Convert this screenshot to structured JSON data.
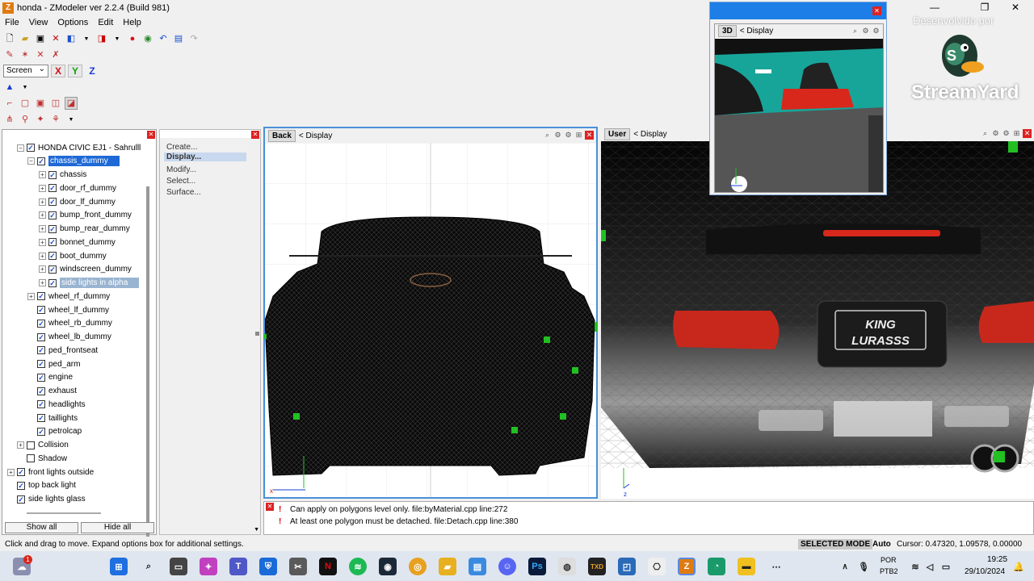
{
  "window": {
    "title": "honda - ZModeler ver 2.2.4 (Build 981)",
    "app_icon": "Z",
    "controls": [
      "—",
      "❐",
      "✕"
    ]
  },
  "menu": [
    "File",
    "View",
    "Options",
    "Edit",
    "Help"
  ],
  "toolbar": {
    "space_select": "Screen",
    "axis_x": "X",
    "axis_y": "Y",
    "axis_z": "Z"
  },
  "tree": {
    "nodes": [
      {
        "label": "HONDA CIVIC EJ1 - Sahrulll",
        "level": 0,
        "expander": "⊟",
        "checked": true
      },
      {
        "label": "chassis_dummy",
        "level": 1,
        "expander": "⊟",
        "checked": true,
        "highlight": "selected"
      },
      {
        "label": "chassis",
        "level": 2,
        "expander": "⊞",
        "checked": true
      },
      {
        "label": "door_rf_dummy",
        "level": 2,
        "expander": "⊞",
        "checked": true
      },
      {
        "label": "door_lf_dummy",
        "level": 2,
        "expander": "⊞",
        "checked": true
      },
      {
        "label": "bump_front_dummy",
        "level": 2,
        "expander": "⊞",
        "checked": true
      },
      {
        "label": "bump_rear_dummy",
        "level": 2,
        "expander": "⊞",
        "checked": true
      },
      {
        "label": "bonnet_dummy",
        "level": 2,
        "expander": "⊞",
        "checked": true
      },
      {
        "label": "boot_dummy",
        "level": 2,
        "expander": "⊞",
        "checked": true
      },
      {
        "label": "windscreen_dummy",
        "level": 2,
        "expander": "⊞",
        "checked": true
      },
      {
        "label": "side lights in alpha",
        "level": 2,
        "expander": "⊞",
        "checked": true,
        "highlight": "hover"
      },
      {
        "label": "wheel_rf_dummy",
        "level": 1,
        "expander": "⊞",
        "checked": true
      },
      {
        "label": "wheel_lf_dummy",
        "level": 1,
        "expander": "",
        "checked": true
      },
      {
        "label": "wheel_rb_dummy",
        "level": 1,
        "expander": "",
        "checked": true
      },
      {
        "label": "wheel_lb_dummy",
        "level": 1,
        "expander": "",
        "checked": true
      },
      {
        "label": "ped_frontseat",
        "level": 1,
        "expander": "",
        "checked": true
      },
      {
        "label": "ped_arm",
        "level": 1,
        "expander": "",
        "checked": true
      },
      {
        "label": "engine",
        "level": 1,
        "expander": "",
        "checked": true
      },
      {
        "label": "exhaust",
        "level": 1,
        "expander": "",
        "checked": true
      },
      {
        "label": "headlights",
        "level": 1,
        "expander": "",
        "checked": true
      },
      {
        "label": "taillights",
        "level": 1,
        "expander": "",
        "checked": true
      },
      {
        "label": "petrolcap",
        "level": 1,
        "expander": "",
        "checked": true
      },
      {
        "label": "Collision",
        "level": 0.5,
        "expander": "⊞",
        "checked": false
      },
      {
        "label": "Shadow",
        "level": 0.5,
        "expander": "",
        "checked": false
      },
      {
        "label": "front lights outside",
        "level": -0.5,
        "expander": "⊞",
        "checked": true
      },
      {
        "label": "top back light",
        "level": -0.5,
        "expander": "",
        "checked": true
      },
      {
        "label": "side lights glass",
        "level": -0.5,
        "expander": "",
        "checked": true
      }
    ],
    "show_all": "Show all",
    "hide_all": "Hide all"
  },
  "options": {
    "items": [
      "Create...",
      "Display...",
      "Modify...",
      "Select...",
      "Surface..."
    ],
    "active": "Display..."
  },
  "viewports": {
    "back": {
      "tag": "Back",
      "mode": "< Display"
    },
    "user": {
      "tag": "User",
      "mode": "< Display"
    },
    "float": {
      "tag": "3D",
      "mode": "< Display"
    }
  },
  "plate_text": [
    "KING",
    "LURASSS"
  ],
  "log": [
    "Can apply on polygons level only. file:byMaterial.cpp line:272",
    "At least one polygon must be detached. file:Detach.cpp line:380"
  ],
  "status": {
    "hint": "Click and drag to move. Expand options box for additional settings.",
    "mode": "SELECTED MODE",
    "auto": "Auto",
    "cursor": "Cursor: 0.47320, 1.09578, 0.00000"
  },
  "watermark": {
    "line1": "Desenvolvido por",
    "brand": "StreamYard"
  },
  "taskbar": {
    "lang1": "POR",
    "lang2": "PTB2",
    "time": "19:25",
    "date": "29/10/2024",
    "badge": "1"
  },
  "colors": {
    "selection": "#1e69d6",
    "hover_selection": "#99b4d1",
    "titlebar_float": "#1c7ee6",
    "error": "#dd0000",
    "taillight": "#d8281c",
    "marker": "#22c022",
    "teal": "#17a59a"
  }
}
